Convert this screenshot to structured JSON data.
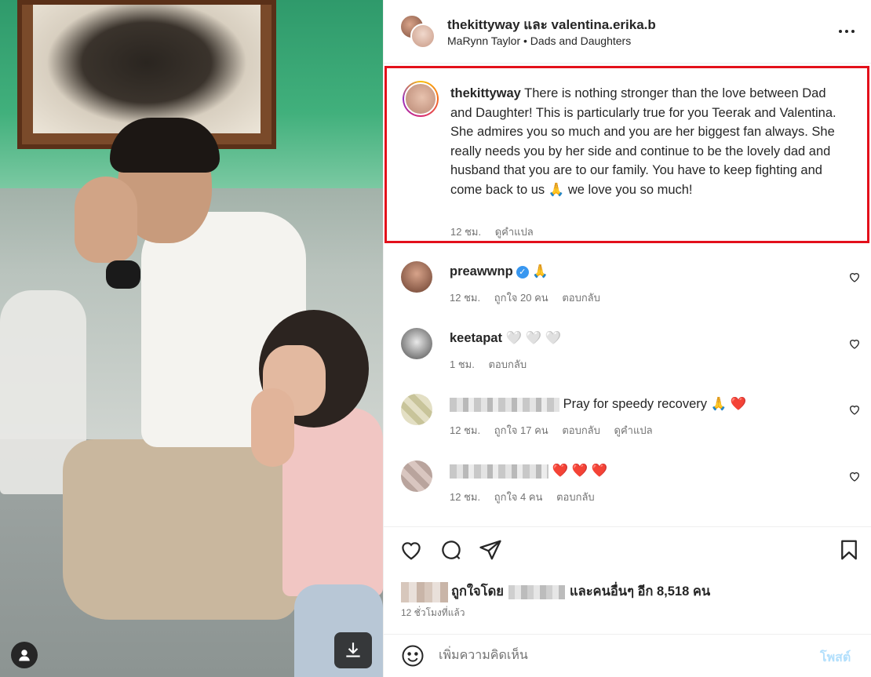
{
  "header": {
    "title": "thekittyway และ valentina.erika.b",
    "subtitle": "MaRynn Taylor • Dads and Daughters",
    "more_icon": "more-horizontal-icon"
  },
  "caption": {
    "username": "thekittyway",
    "text": "There is nothing stronger than the love between Dad and Daughter! This is particularly true for you Teerak and Valentina. She admires you so much and you are her biggest fan always. She really needs you by her side and continue to be the lovely dad and husband that you are to our family. You have to keep fighting and come back to us 🙏 we love you so much!",
    "time": "12 ชม.",
    "translate": "ดูคำแปล"
  },
  "comments": [
    {
      "username": "preawwnp",
      "verified": true,
      "text": "🙏",
      "time": "12 ชม.",
      "likes": "ถูกใจ 20 คน",
      "reply": "ตอบกลับ"
    },
    {
      "username": "keetapat",
      "text": "🤍 🤍 🤍",
      "time": "1 ชม.",
      "reply": "ตอบกลับ"
    },
    {
      "username": "",
      "text": "Pray for speedy recovery 🙏 ❤️",
      "time": "12 ชม.",
      "likes": "ถูกใจ 17 คน",
      "reply": "ตอบกลับ",
      "translate": "ดูคำแปล"
    },
    {
      "username": "",
      "text": "❤️ ❤️ ❤️",
      "time": "12 ชม.",
      "likes": "ถูกใจ 4 คน",
      "reply": "ตอบกลับ"
    }
  ],
  "likes": {
    "prefix": "ถูกใจโดย",
    "suffix": "และคนอื่นๆ อีก 8,518 คน"
  },
  "timestamp": "12 ชั่วโมงที่แล้ว",
  "composer": {
    "placeholder": "เพิ่มความคิดเห็น",
    "post_label": "โพสต์"
  },
  "colors": {
    "highlight_border": "#e3101b",
    "post_button": "#b2dffc",
    "meta_text": "#737373"
  }
}
